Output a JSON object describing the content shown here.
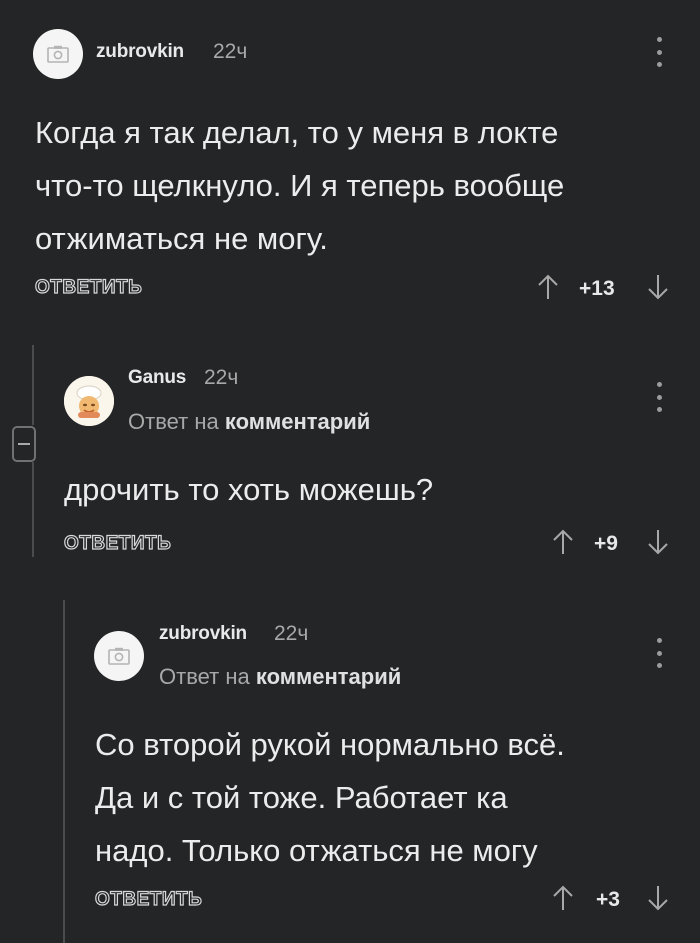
{
  "comments": [
    {
      "username": "zubrovkin",
      "time": "22ч",
      "text": "Когда я так делал, то у меня  в локте\nчто-то щелкнуло. И я теперь вообще\nотжиматься не могу.",
      "reply_label": "ОТВЕТИТЬ",
      "score": "+13",
      "avatar_icon": "camera-icon"
    },
    {
      "username": "Ganus",
      "time": "22ч",
      "reply_prefix": "Ответ на",
      "reply_target": "комментарий",
      "text": "дрочить то хоть можешь?",
      "reply_label": "ОТВЕТИТЬ",
      "score": "+9",
      "avatar_icon": "cook-avatar-icon"
    },
    {
      "username": "zubrovkin",
      "time": "22ч",
      "reply_prefix": "Ответ на",
      "reply_target": "комментарий",
      "text": "Со второй рукой нормально всё.\nДа и с той тоже. Работает ка\nнадо. Только отжаться не могу",
      "reply_label": "ОТВЕТИТЬ",
      "score": "+3",
      "avatar_icon": "camera-icon"
    }
  ],
  "colors": {
    "background": "#232527",
    "text": "#ececec",
    "muted": "#a8a8a8",
    "thread_line": "#4a4c4e"
  }
}
